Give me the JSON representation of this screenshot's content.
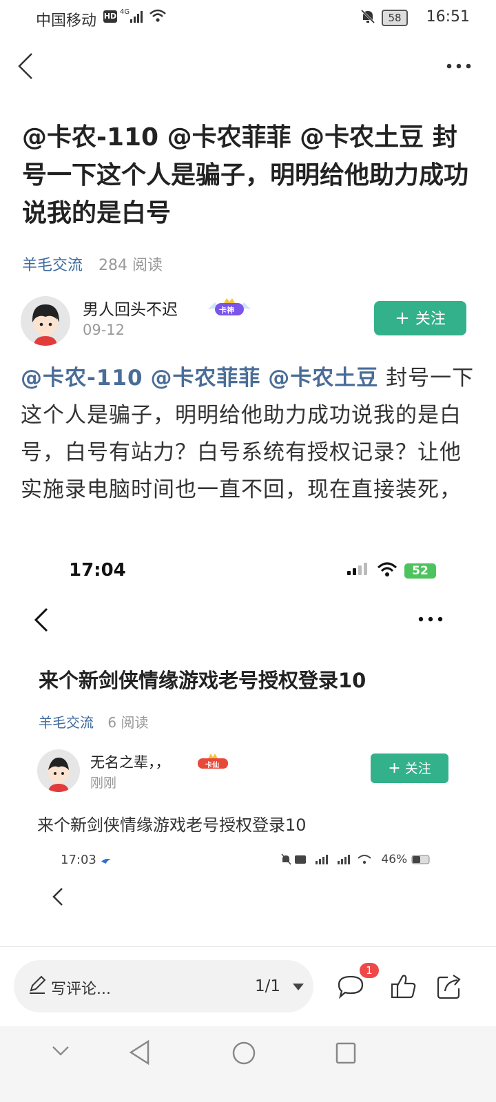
{
  "status_bar": {
    "carrier": "中国移动",
    "hd": "HD",
    "network": "4G",
    "battery": "58",
    "time": "16:51"
  },
  "post": {
    "title": "@卡农-110 @卡农菲菲 @卡农土豆 封号一下这个人是骗子，明明给他助力成功说我的是白号",
    "category": "羊毛交流",
    "reads": "284 阅读",
    "author": {
      "name": "男人回头不迟",
      "date": "09-12",
      "badge": "卡神"
    },
    "follow_label": "关注",
    "mentions": [
      "@卡农-110",
      "@卡农菲菲",
      "@卡农土豆"
    ],
    "body": " 封号一下这个人是骗子，明明给他助力成功说我的是白号，白号有站力？白号系统有授权记录？让他实施录电脑时间也一直不回，现在直接装死，"
  },
  "embedded": {
    "time": "17:04",
    "battery": "52",
    "title": "来个新剑侠情缘游戏老号授权登录10",
    "category": "羊毛交流",
    "reads": "6 阅读",
    "author": {
      "name": "无名之辈，，",
      "date": "刚刚",
      "badge": "卡仙"
    },
    "follow_label": "关注",
    "body": "来个新剑侠情缘游戏老号授权登录10",
    "nested_time": "17:03",
    "nested_battery": "46%"
  },
  "toolbar": {
    "comment_placeholder": "写评论...",
    "pager": "1/1",
    "comment_count": "1"
  },
  "colors": {
    "accent": "#33b18a",
    "link": "#4a6d97",
    "badge_red": "#f04848"
  }
}
